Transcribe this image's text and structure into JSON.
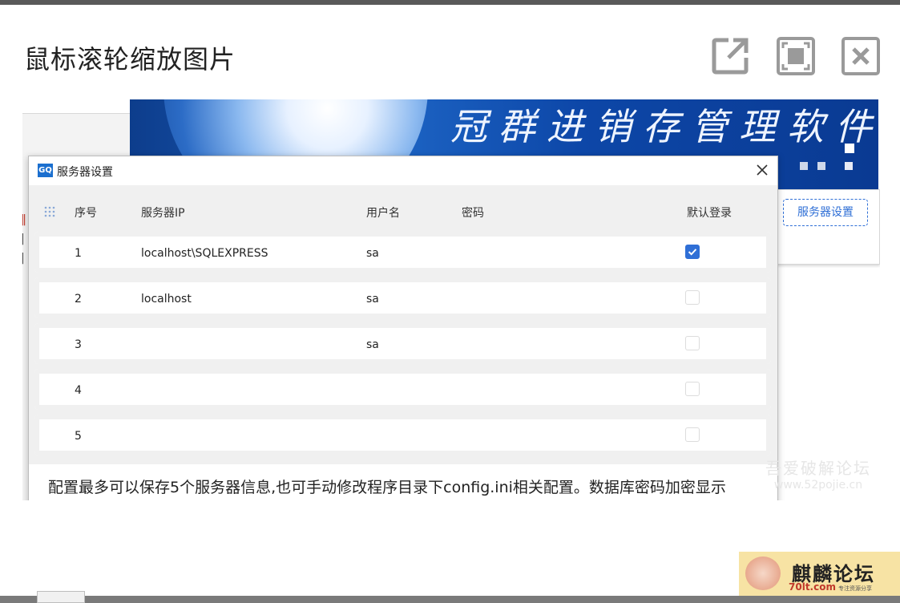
{
  "viewer": {
    "title": "鼠标滚轮缩放图片",
    "buttons": [
      {
        "name": "open-external-button",
        "icon": "open-external-icon"
      },
      {
        "name": "fit-screen-button",
        "icon": "fit-screen-icon"
      },
      {
        "name": "close-button",
        "icon": "close-icon"
      }
    ]
  },
  "banner": {
    "title": "冠群进销存管理软件"
  },
  "background": {
    "server_settings_button": "服务器设置",
    "accent": "#2f6fd6"
  },
  "dialog": {
    "title": "服务器设置",
    "app_icon_text": "GQ",
    "columns": {
      "seq": "序号",
      "ip": "服务器IP",
      "user": "用户名",
      "password": "密码",
      "default_login": "默认登录"
    },
    "rows": [
      {
        "seq": "1",
        "ip": "localhost\\SQLEXPRESS",
        "user": "sa",
        "password": "",
        "default_login": true
      },
      {
        "seq": "2",
        "ip": "localhost",
        "user": "sa",
        "password": "",
        "default_login": false
      },
      {
        "seq": "3",
        "ip": "",
        "user": "sa",
        "password": "",
        "default_login": false
      },
      {
        "seq": "4",
        "ip": "",
        "user": "",
        "password": "",
        "default_login": false
      },
      {
        "seq": "5",
        "ip": "",
        "user": "",
        "password": "",
        "default_login": false
      }
    ],
    "note": "配置最多可以保存5个服务器信息,也可手动修改程序目录下config.ini相关配置。数据库密码加密显示"
  },
  "watermark": {
    "line1": "吾爱破解论坛",
    "line2": "www.52pojie.cn"
  },
  "brand": {
    "name": "麒麟论坛",
    "url": "70lt.com",
    "tagline": "专注资源分享"
  }
}
